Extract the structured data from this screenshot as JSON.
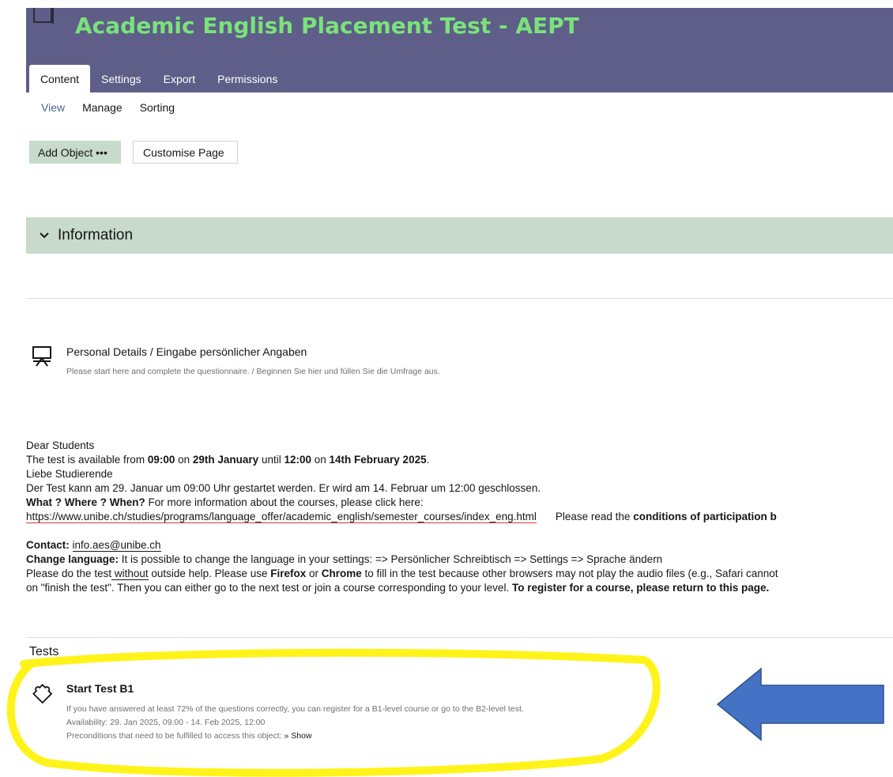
{
  "window": {
    "title": "Academic English Placement Test - AEPT",
    "title_color": "#7be27b"
  },
  "header": {
    "background": "#5e5e88"
  },
  "tabs": [
    {
      "label": "Content",
      "active": true
    },
    {
      "label": "Settings",
      "active": false
    },
    {
      "label": "Export",
      "active": false
    },
    {
      "label": "Permissions",
      "active": false
    }
  ],
  "subtabs": [
    {
      "label": "View",
      "active": true
    },
    {
      "label": "Manage",
      "active": false
    },
    {
      "label": "Sorting",
      "active": false
    }
  ],
  "toolbar": {
    "add_object_label": "Add Object •••",
    "customise_label": "Customise Page"
  },
  "info_block": {
    "label": "Information",
    "icon": "chevron-down-icon"
  },
  "survey": {
    "icon": "presentation-board-icon",
    "title": "Personal Details / Eingabe persönlicher Angaben",
    "description": "Please start here and complete the questionnaire. / Beginnen Sie hier und füllen Sie die Umfrage aus."
  },
  "notice": {
    "greeting_en": "Dear Students",
    "availability_prefix": "The test is available from ",
    "start_time": "09:00",
    "on_1": " on ",
    "start_date": "29th January",
    "until": " until ",
    "end_time": "12:00",
    "on_2": " on ",
    "end_date": "14th February 2025",
    "period": ".",
    "greeting_de": "Liebe Studierende",
    "availability_de": "Der Test kann am 29. Januar um 09:00 Uhr gestartet werden. Er wird am 14. Februar um 12:00 geschlossen.",
    "www_label": "What ? Where ? When?",
    "www_text": " For more information about the courses, please click here:",
    "courses_url": "https://www.unibe.ch/studies/programs/language_offer/academic_english/semester_courses/index_eng.html",
    "read_prefix": "Please read the ",
    "read_bold": "conditions of participation b",
    "contact_label": "Contact:",
    "contact_email": "info.aes@unibe.ch",
    "lang_label": "Change language:",
    "lang_text": " It is possible to change the language in your settings: => Persönlicher Schreibtisch => Settings => Sprache ändern",
    "help_prefix": "Please do the test",
    "help_link": " without",
    "help_middle": " outside help. Please use ",
    "firefox": "Firefox",
    "or": " or ",
    "chrome": "Chrome",
    "help_suffix": " to fill in the test because other browsers may not play the audio files (e.g., Safari cannot",
    "finish_text": "on \"finish the test\". Then you can either go to the next test or join a course corresponding to your level. ",
    "register_bold": "To register for a course, please return to this page."
  },
  "tests_section": {
    "heading": "Tests",
    "items": [
      {
        "icon": "puzzle-piece-icon",
        "title": "Start Test B1",
        "description": "If you have answered at least 72% of the questions correctly, you can register for a B1-level course or go to the B2-level test.",
        "availability": "Availability: 29. Jan 2025, 09:00 - 14. Feb 2025, 12:00",
        "preconditions": "Preconditions that need to be fulfilled to access this object: ",
        "show_label": "» Show"
      }
    ]
  },
  "annotations": {
    "highlight_color": "#fff200",
    "arrow_color": "#4472c4"
  }
}
